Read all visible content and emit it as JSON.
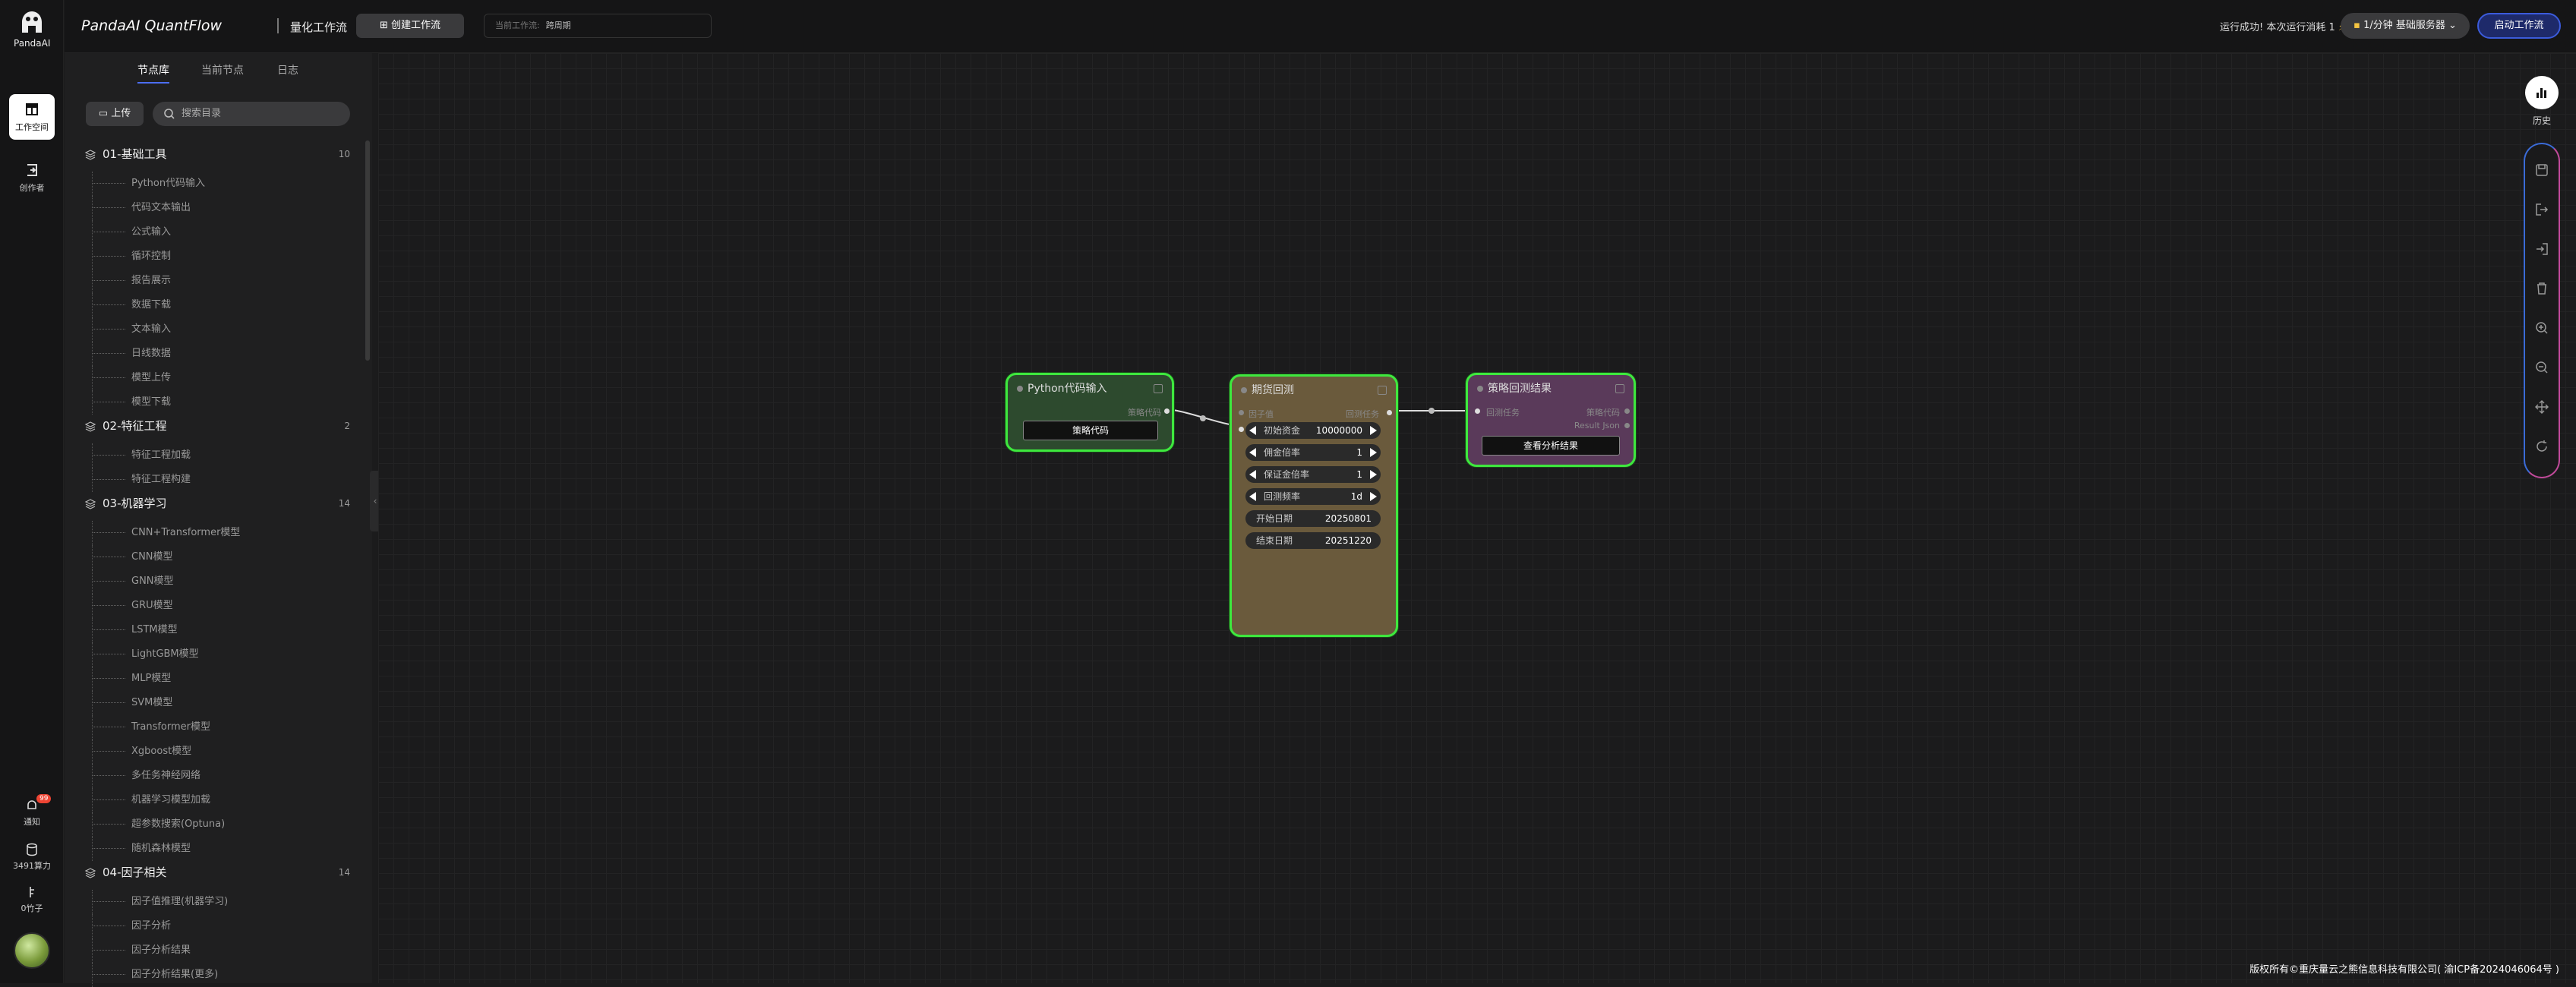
{
  "app": {
    "logo_text": "PandaAI",
    "brand": "PandaAI QuantFlow",
    "subtitle": "量化工作流"
  },
  "rail": {
    "workspace": "工作空间",
    "creator": "创作者",
    "notify": "通知",
    "notify_badge": "99",
    "compute": "3491算力",
    "coins": "0竹子"
  },
  "topbar": {
    "create_label": "创建工作流",
    "current_label": "当前工作流:",
    "current_value": "跨周期",
    "status": "运行成功! 本次运行消耗 1",
    "server": "1/分钟  基础服务器",
    "launch": "启动工作流"
  },
  "panel": {
    "tabs": [
      "节点库",
      "当前节点",
      "日志"
    ],
    "upload": "上传",
    "search_placeholder": "搜索目录",
    "categories": [
      {
        "name": "01-基础工具",
        "count": "10",
        "items": [
          "Python代码输入",
          "代码文本输出",
          "公式输入",
          "循环控制",
          "报告展示",
          "数据下载",
          "文本输入",
          "日线数据",
          "模型上传",
          "模型下载"
        ]
      },
      {
        "name": "02-特征工程",
        "count": "2",
        "items": [
          "特征工程加载",
          "特征工程构建"
        ]
      },
      {
        "name": "03-机器学习",
        "count": "14",
        "items": [
          "CNN+Transformer模型",
          "CNN模型",
          "GNN模型",
          "GRU模型",
          "LSTM模型",
          "LightGBM模型",
          "MLP模型",
          "SVM模型",
          "Transformer模型",
          "Xgboost模型",
          "多任务神经网络",
          "机器学习模型加载",
          "超参数搜索(Optuna)",
          "随机森林模型"
        ]
      },
      {
        "name": "04-因子相关",
        "count": "14",
        "items": [
          "因子值推理(机器学习)",
          "因子分析",
          "因子分析结果",
          "因子分析结果(更多)"
        ]
      }
    ]
  },
  "nodes": {
    "python": {
      "title": "Python代码输入",
      "out_port": "策略代码",
      "button": "策略代码"
    },
    "backtest": {
      "title": "期货回测",
      "in_port": "因子值",
      "out_port": "回测任务",
      "params": [
        {
          "label": "初始资金",
          "value": "10000000"
        },
        {
          "label": "佣金倍率",
          "value": "1"
        },
        {
          "label": "保证金倍率",
          "value": "1"
        },
        {
          "label": "回测频率",
          "value": "1d"
        },
        {
          "label": "开始日期",
          "value": "20250801"
        },
        {
          "label": "结束日期",
          "value": "20251220"
        }
      ]
    },
    "result": {
      "title": "策略回测结果",
      "in_port": "回测任务",
      "out_port1": "策略代码",
      "out_port2": "Result Json",
      "button": "查看分析结果"
    }
  },
  "right": {
    "history": "历史"
  },
  "footer": {
    "copyright": "版权所有©重庆量云之熊信息科技有限公司( 渝ICP备2024046064号 )"
  },
  "colors": {
    "accent": "#4c6ef5",
    "node_border": "#3ee83e",
    "python_node": "#2d4a2e",
    "backtest_node": "#6a5a3c",
    "result_node": "#5a3a5a"
  }
}
